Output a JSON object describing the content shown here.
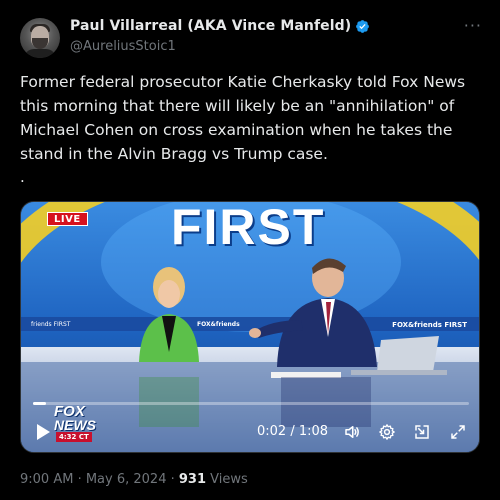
{
  "author": {
    "display_name": "Paul Villarreal (AKA Vince Manfeld)",
    "handle": "@AureliusStoic1",
    "verified_color": "#1d9bf0"
  },
  "post": {
    "text": "Former federal prosecutor Katie Cherkasky told Fox News this morning that there will likely be an \"annihilation\" of Michael Cohen on cross examination when he takes the stand in the Alvin Bragg vs Trump case.",
    "trailing_dot": "."
  },
  "video": {
    "live_badge": "LIVE",
    "banner_text": "FIRST",
    "ticker_left": "friends FIRST",
    "ticker_mid": "FOX&friends",
    "ticker_right": "FOX&friends FIRST",
    "network_logo_line1": "FOX",
    "network_logo_line2": "NEWS",
    "network_time": "4:32 CT",
    "time_display": "0:02 / 1:08",
    "progress_fraction": 0.03,
    "controls": [
      "play-icon",
      "volume-icon",
      "settings-icon",
      "exit-fullscreen-icon",
      "fullscreen-icon"
    ]
  },
  "meta": {
    "timestamp": "9:00 AM · May 6, 2024 · ",
    "views_count": "931",
    "views_label": " Views"
  },
  "colors": {
    "background": "#000000",
    "text_primary": "#e7e9ea",
    "text_secondary": "#71767b",
    "live_red": "#d6121e"
  }
}
